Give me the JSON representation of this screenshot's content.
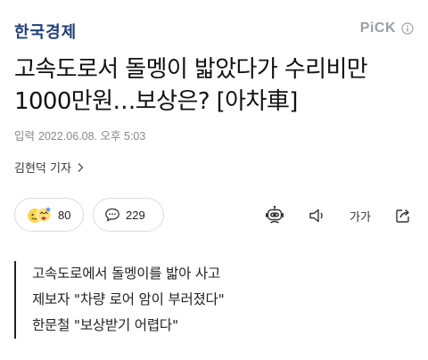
{
  "header": {
    "press_name": "한국경제",
    "pick_label": "PiCK"
  },
  "article": {
    "title_line1": "고속도로서 돌멩이 밟았다가 수리비만",
    "title_line2": "1000만원…보상은? [아차車]",
    "date_label": "입력",
    "date_value": "2022.06.08. 오후 5:03",
    "reporter": "김현덕 기자"
  },
  "actions": {
    "reaction_count": "80",
    "comment_count": "229",
    "font_size_label": "가가"
  },
  "summary": {
    "lines": [
      "고속도로에서 돌멩이를 밟아 사고",
      "제보자 \"차량 로어 암이 부러졌다\"",
      "한문철 \"보상받기 어렵다\""
    ]
  },
  "colors": {
    "press_logo": "#1f3f78",
    "pick": "#9aa0a6",
    "text": "#111111",
    "muted": "#8a8a8a"
  },
  "icons": {
    "pick_info": "info-icon",
    "reporter_more": "chevron-right-icon",
    "reaction": "emoji-reaction-icon",
    "comment": "speech-bubble-icon",
    "summary_bot": "robot-icon",
    "tts": "speaker-icon",
    "share": "share-icon"
  }
}
